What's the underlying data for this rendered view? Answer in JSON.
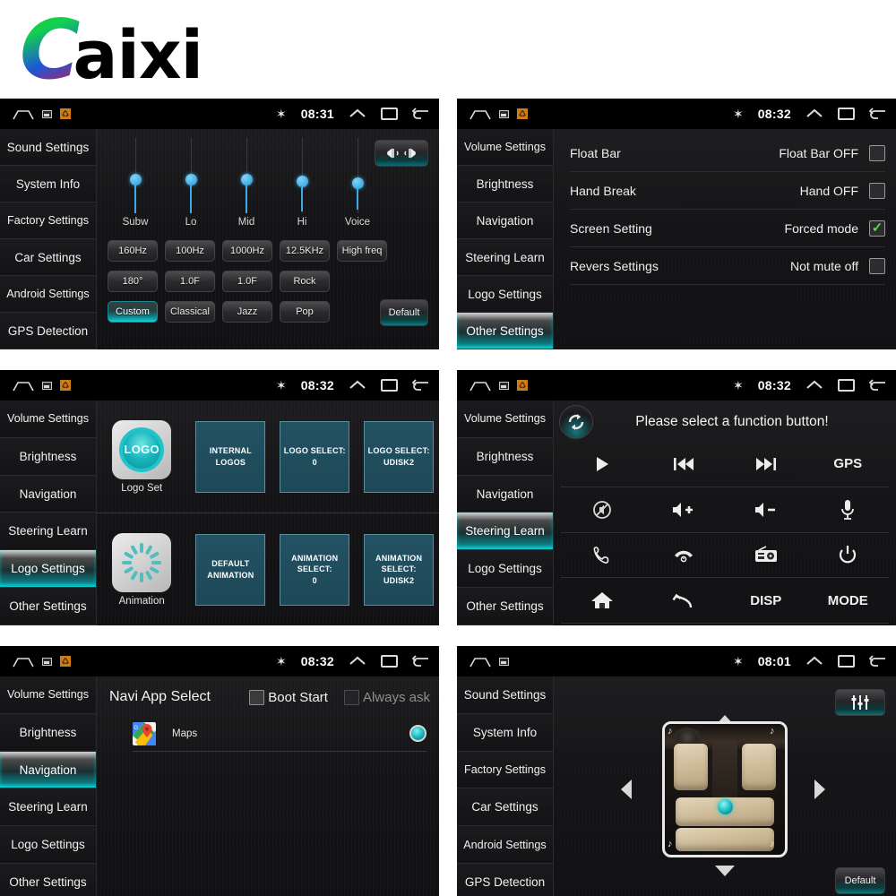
{
  "brand": {
    "first_letter": "C",
    "rest": "aixi"
  },
  "statusbar": {
    "icons": {
      "home": "home-icon",
      "screenshot": "screenshot-icon",
      "app": "app-icon",
      "bluetooth": "✶",
      "expand": "chevron-up-icon",
      "recents": "recents-icon",
      "back": "back-icon"
    }
  },
  "panels": [
    {
      "id": "sound-settings",
      "time": "08:31",
      "sidebar": {
        "items": [
          "Sound Settings",
          "System Info",
          "Factory Settings",
          "Car Settings",
          "Android Settings",
          "GPS Detection"
        ],
        "active": -1
      },
      "equalizer": {
        "bands": [
          {
            "label": "Subw",
            "value": 50
          },
          {
            "label": "Lo",
            "value": 50
          },
          {
            "label": "Mid",
            "value": 50
          },
          {
            "label": "Hi",
            "value": 48
          },
          {
            "label": "Voice",
            "value": 46
          }
        ],
        "balance_button": "balance-icon",
        "row1": [
          "160Hz",
          "100Hz",
          "1000Hz",
          "12.5KHz",
          "High freq"
        ],
        "row2": [
          "180°",
          "1.0F",
          "1.0F",
          "Rock"
        ],
        "row3": [
          "Custom",
          "Classical",
          "Jazz",
          "Pop"
        ],
        "row3_active": 0,
        "default_label": "Default"
      }
    },
    {
      "id": "other-settings",
      "time": "08:32",
      "sidebar": {
        "items": [
          "Volume Settings",
          "Brightness",
          "Navigation",
          "Steering Learn",
          "Logo Settings",
          "Other Settings"
        ],
        "active": 5
      },
      "options": [
        {
          "name": "Float Bar",
          "value": "Float Bar OFF",
          "checked": false
        },
        {
          "name": "Hand Break",
          "value": "Hand OFF",
          "checked": false
        },
        {
          "name": "Screen Setting",
          "value": "Forced mode",
          "checked": true
        },
        {
          "name": "Revers Settings",
          "value": "Not mute off",
          "checked": false
        }
      ],
      "check_glyph": "✓"
    },
    {
      "id": "logo-settings",
      "time": "08:32",
      "sidebar": {
        "items": [
          "Volume Settings",
          "Brightness",
          "Navigation",
          "Steering Learn",
          "Logo Settings",
          "Other Settings"
        ],
        "active": 4
      },
      "logo": {
        "icon_text": "LOGO",
        "caption": "Logo Set",
        "tiles": [
          "INTERNAL LOGOS",
          "LOGO SELECT:\n0",
          "LOGO SELECT:\nUDISK2"
        ]
      },
      "animation": {
        "caption": "Animation",
        "tiles": [
          "DEFAULT\nANIMATION",
          "ANIMATION\nSELECT:\n0",
          "ANIMATION\nSELECT:\nUDISK2"
        ]
      }
    },
    {
      "id": "steering-learn",
      "time": "08:32",
      "sidebar": {
        "items": [
          "Volume Settings",
          "Brightness",
          "Navigation",
          "Steering Learn",
          "Logo Settings",
          "Other Settings"
        ],
        "active": 3
      },
      "title": "Please select a function button!",
      "refresh_icon": "refresh-icon",
      "buttons": [
        {
          "name": "play-button",
          "label": "",
          "icon": "play-icon"
        },
        {
          "name": "previous-track-button",
          "label": "",
          "icon": "previous-icon"
        },
        {
          "name": "next-track-button",
          "label": "",
          "icon": "next-icon"
        },
        {
          "name": "gps-button",
          "label": "GPS",
          "icon": ""
        },
        {
          "name": "mute-button",
          "label": "",
          "icon": "mute-icon"
        },
        {
          "name": "volume-up-button",
          "label": "",
          "icon": "volume-up-icon"
        },
        {
          "name": "volume-down-button",
          "label": "",
          "icon": "volume-down-icon"
        },
        {
          "name": "microphone-button",
          "label": "",
          "icon": "mic-icon"
        },
        {
          "name": "call-answer-button",
          "label": "",
          "icon": "phone-icon"
        },
        {
          "name": "call-end-button",
          "label": "",
          "icon": "phone-hangup-icon"
        },
        {
          "name": "radio-button",
          "label": "",
          "icon": "radio-icon"
        },
        {
          "name": "power-button",
          "label": "",
          "icon": "power-icon"
        },
        {
          "name": "home-button",
          "label": "",
          "icon": "house-icon"
        },
        {
          "name": "back-button",
          "label": "",
          "icon": "undo-icon"
        },
        {
          "name": "disp-button",
          "label": "DISP",
          "icon": ""
        },
        {
          "name": "mode-button",
          "label": "MODE",
          "icon": ""
        }
      ]
    },
    {
      "id": "navigation",
      "time": "08:32",
      "sidebar": {
        "items": [
          "Volume Settings",
          "Brightness",
          "Navigation",
          "Steering Learn",
          "Logo Settings",
          "Other Settings"
        ],
        "active": 2
      },
      "title": "Navi App Select",
      "boot_start": "Boot Start",
      "always_ask": "Always ask",
      "apps": [
        {
          "name": "Maps",
          "selected": true
        }
      ]
    },
    {
      "id": "car-settings",
      "time": "08:01",
      "sidebar": {
        "items": [
          "Sound Settings",
          "System Info",
          "Factory Settings",
          "Car Settings",
          "Android Settings",
          "GPS Detection"
        ],
        "active": -1
      },
      "fader": {
        "up": "▲",
        "down": "▼",
        "left": "◀",
        "right": "▶",
        "eq_button": "equalizer-icon",
        "default_label": "Default"
      }
    }
  ]
}
